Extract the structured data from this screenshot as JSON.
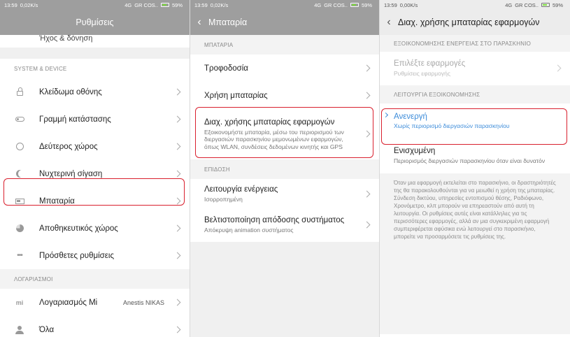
{
  "status_left": {
    "time": "13:59",
    "net_speed_1": "0,02K/s",
    "net_speed_2": "0,00K/s",
    "network": "4G",
    "carrier": "GR COS..",
    "battery": "59%"
  },
  "settings": {
    "title": "Ρυθμίσεις",
    "cut_item": "Ήχος & δόνηση",
    "section_system": "SYSTEM & DEVICE",
    "items": [
      {
        "label": "Κλείδωμα οθόνης",
        "icon": "lock-icon"
      },
      {
        "label": "Γραμμή κατάστασης",
        "icon": "toggle-icon"
      },
      {
        "label": "Δεύτερος χώρος",
        "icon": "second-space-icon"
      },
      {
        "label": "Νυχτερινή σίγαση",
        "icon": "moon-icon"
      },
      {
        "label": "Μπαταρία",
        "icon": "battery-icon"
      },
      {
        "label": "Αποθηκευτικός χώρος",
        "icon": "storage-icon"
      },
      {
        "label": "Πρόσθετες ρυθμίσεις",
        "icon": "more-icon"
      }
    ],
    "section_accounts": "ΛΟΓΑΡΙΑΣΜΟΙ",
    "accounts": [
      {
        "label": "Λογαριασμός Mi",
        "value": "Anestis NIKAS",
        "icon": "mi-icon"
      },
      {
        "label": "Όλα",
        "icon": "user-icon"
      }
    ]
  },
  "battery": {
    "title": "Μπαταρία",
    "section_battery": "ΜΠΑΤΑΡΙΑ",
    "power_supply": "Τροφοδοσία",
    "usage": "Χρήση μπαταρίας",
    "app_mgmt_title": "Διαχ. χρήσης μπαταρίας εφαρμογών",
    "app_mgmt_sub": "Εξοικονομήστε μπαταρία, μέσω του περιορισμού των διεργασιών παρασκηνίου μεμονωμένων εφαρμογών, όπως WLAN, συνδέσεις δεδομένων κινητής και GPS",
    "section_performance": "ΕΠΙΔΟΣΗ",
    "power_mode": "Λειτουργία ενέργειας",
    "power_mode_sub": "Ισορροπημένη",
    "optimize": "Βελτιστοποίηση απόδοσης συστήματος",
    "optimize_sub": "Απόκρυψη animation συστήματος"
  },
  "app_battery": {
    "title": "Διαχ. χρήσης μπαταρίας εφαρμογών",
    "section_bg": "ΕΞΟΙΚΟΝΟΜΗΣΗΣ ΕΝΕΡΓΕΙΑΣ ΣΤΟ ΠΑΡΑΣΚΗΝΙΟ",
    "choose_apps": "Επιλέξτε εφαρμογές",
    "choose_apps_sub": "Ρυθμίσεις εφαρμογής",
    "section_mode": "ΛΕΙΤΟΥΡΓΙΑ ΕΞΟΙΚΟΝΟΜΗΣΗΣ",
    "off": "Ανενεργή",
    "off_sub": "Χωρίς περιορισμό διεργασιών παρασκηνίου",
    "on": "Ενισχυμένη",
    "on_sub": "Περιορισμός διεργασιών παρασκηνίου όταν είναι δυνατόν",
    "info": "Όταν μια εφαρμογή εκτελείται στο παρασκήνιο, οι δραστηριότητές της θα παρακολουθούνται για να μειωθεί η χρήση της μπαταρίας. Σύνδεση δικτύου, υπηρεσίες εντοπισμού θέσης, Ραδιόφωνο, Χρονόμετρο, κλπ μπορούν να επηρεαστούν από αυτή τη λειτουργία. Οι ρυθμίσεις αυτές είναι κατάλληλες για τις περισσότερες εφαρμογές, αλλά αν μια συγκεκριμένη εφαρμογή συμπεριφέρεται αφύσικα ενώ λειτουργεί στο παρασκήνιο, μπορείτε να προσαρμόσετε τις ρυθμίσεις της."
  },
  "colors": {
    "highlight": "#d9202e",
    "accent": "#3b8bd9",
    "header_grey": "#9e9e9e"
  }
}
